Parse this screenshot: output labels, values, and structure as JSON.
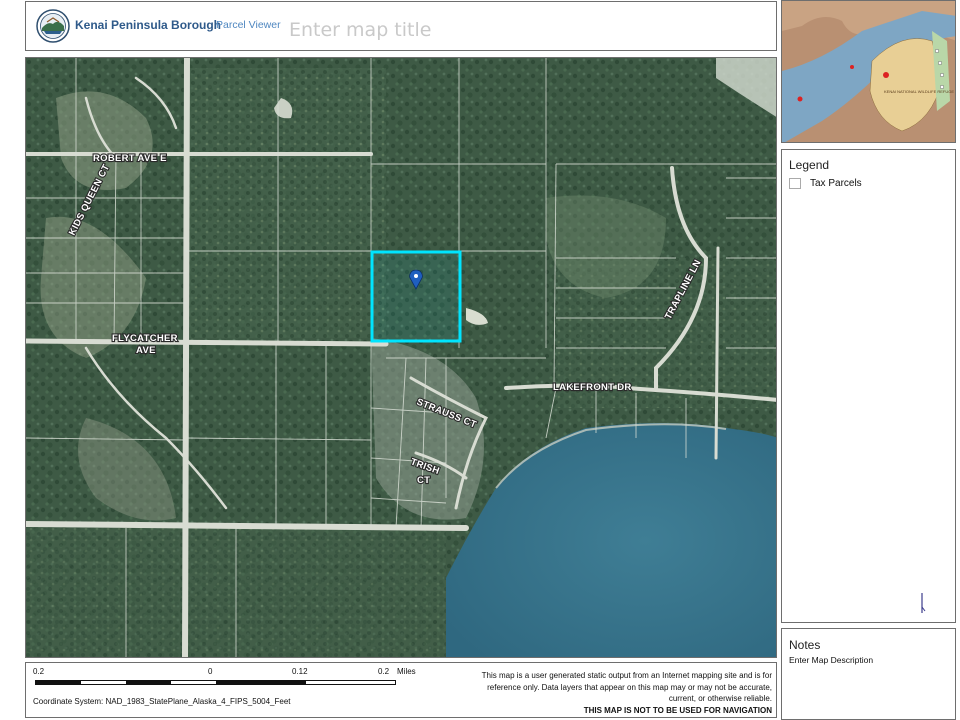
{
  "header": {
    "org_name": "Kenai Peninsula Borough",
    "app_name": "Parcel Viewer",
    "map_title_placeholder": "Enter map title"
  },
  "map": {
    "road_labels": [
      {
        "name": "road-label-robert",
        "text": "ROBERT AVE E"
      },
      {
        "name": "road-label-kids-queen",
        "text": "KIDS QUEEN CT"
      },
      {
        "name": "road-label-flycatcher-1",
        "text": "FLYCATCHER"
      },
      {
        "name": "road-label-flycatcher-2",
        "text": "AVE"
      },
      {
        "name": "road-label-lakefront",
        "text": "LAKEFRONT DR"
      },
      {
        "name": "road-label-strauss",
        "text": "STRAUSS CT"
      },
      {
        "name": "road-label-trish-1",
        "text": "TRISH"
      },
      {
        "name": "road-label-trish-2",
        "text": "CT"
      },
      {
        "name": "road-label-trapline",
        "text": "TRAPLINE LN"
      }
    ],
    "selection_color": "#00e5ff",
    "marker_color": "#1f5fbf"
  },
  "overview": {
    "labels": [
      "KENAI NATIONAL WILDLIFE REFUGE"
    ]
  },
  "legend": {
    "title": "Legend",
    "items": [
      {
        "label": "Tax Parcels"
      }
    ]
  },
  "notes": {
    "title": "Notes",
    "description": "Enter Map Description"
  },
  "scale": {
    "labels": [
      "0.2",
      "0",
      "0.12",
      "0.2"
    ],
    "unit": "Miles"
  },
  "coordinate_system": "Coordinate System:   NAD_1983_StatePlane_Alaska_4_FIPS_5004_Feet",
  "disclaimer": {
    "line1": "This map is a user generated static output from an Internet mapping site and is for",
    "line2": "reference only. Data layers that appear on this map may or may not be accurate,",
    "line3": "current, or otherwise reliable.",
    "line4": "THIS MAP IS NOT TO BE USED FOR NAVIGATION"
  }
}
